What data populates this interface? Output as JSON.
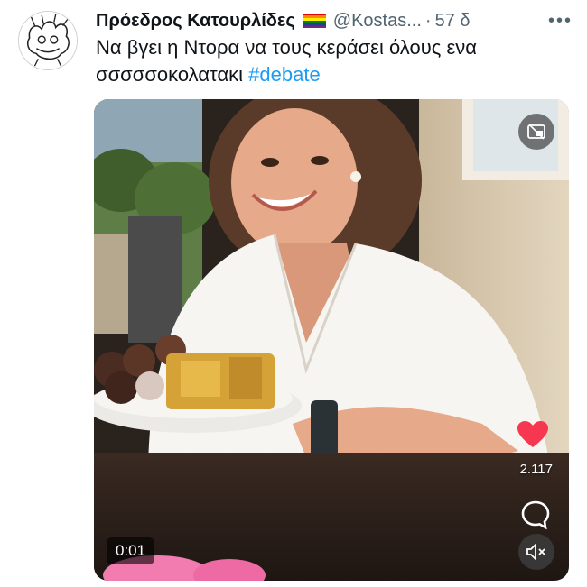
{
  "tweet": {
    "author_name": "Πρόεδρος Κατουρλίδες",
    "author_flag": "rainbow-flag-icon",
    "handle": "@Kostas...",
    "separator": "·",
    "time": "57 δ",
    "more_label": "•••",
    "text": "Να βγει η Ντορα να τους κεράσει όλους ενα σσσσσοκολατακι",
    "hashtag": "#debate"
  },
  "video": {
    "elapsed": "0:01",
    "like_count": "2.117",
    "like_color": "#f91880",
    "icons": [
      "picture-in-picture-icon",
      "heart-icon",
      "comment-icon",
      "mute-icon"
    ]
  },
  "colors": {
    "text": "#0f1419",
    "secondary": "#536471",
    "link": "#1d9bf0"
  }
}
